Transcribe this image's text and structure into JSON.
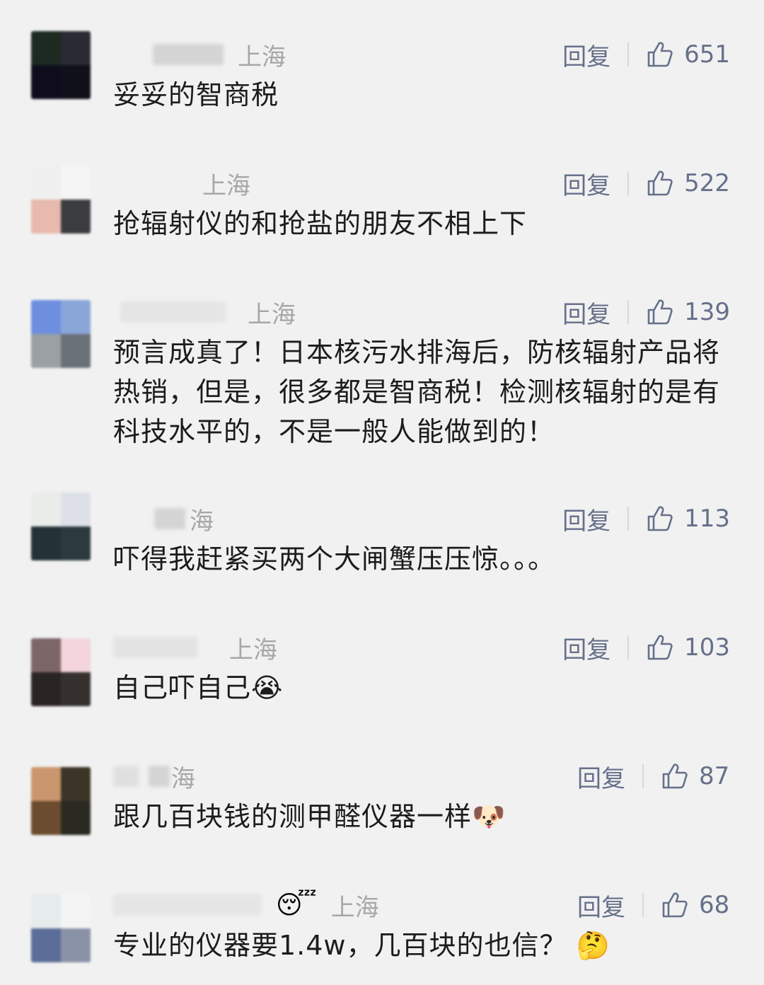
{
  "reply_label": "回复",
  "comments": [
    {
      "name": "",
      "location": "上海",
      "likes": "651",
      "text": "妥妥的智商税",
      "emoji": "",
      "avatar_colors": [
        "#1c2a22",
        "#2a2a32",
        "#0f0c1e",
        "#10101a"
      ]
    },
    {
      "name": "",
      "location": "上海",
      "likes": "522",
      "text": "抢辐射仪的和抢盐的朋友不相上下",
      "emoji": "",
      "avatar_colors": [
        "#f0efef",
        "#f5f5f5",
        "#e8b9ad",
        "#3a3c40"
      ]
    },
    {
      "name": "",
      "location": "上海",
      "likes": "139",
      "text": "预言成真了！日本核污水排海后，防核辐射产品将热销，但是，很多都是智商税！检测核辐射的是有科技水平的，不是一般人能做到的！",
      "emoji": "",
      "avatar_colors": [
        "#6e8fe0",
        "#8aa6d8",
        "#9aa0a4",
        "#6a7078"
      ]
    },
    {
      "name": "",
      "location": "海",
      "likes": "113",
      "text": "吓得我赶紧买两个大闸蟹压压惊。。。",
      "emoji": "",
      "avatar_colors": [
        "#e9ece9",
        "#dde1e7",
        "#243236",
        "#2c3a40"
      ]
    },
    {
      "name": "",
      "location": "上海",
      "likes": "103",
      "text": "自己吓自己",
      "emoji": "😭",
      "avatar_colors": [
        "#7c6668",
        "#f2d4da",
        "#2b2424",
        "#35302e"
      ]
    },
    {
      "name": "",
      "location": "海",
      "likes": "87",
      "text": "跟几百块钱的测甲醛仪器一样",
      "emoji": "🐶",
      "avatar_colors": [
        "#c9966e",
        "#3c3426",
        "#6b4c2e",
        "#2a2a22"
      ]
    },
    {
      "name": "",
      "location": "上海",
      "likes": "68",
      "text": "专业的仪器要1.4w，几百块的也信？",
      "emoji": "🤔",
      "status_emoji": "😴",
      "avatar_colors": [
        "#e6eceb",
        "#f4f4f4",
        "#5b6d98",
        "#8a92a8"
      ]
    }
  ]
}
